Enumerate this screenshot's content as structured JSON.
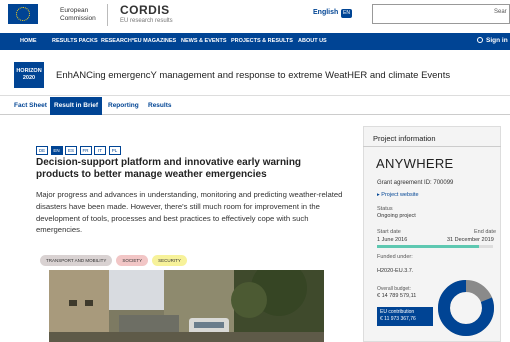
{
  "header": {
    "ec_line1": "European",
    "ec_line2": "Commission",
    "site_name": "CORDIS",
    "site_tagline": "EU research results",
    "language": "English",
    "language_code": "EN",
    "search_button": "Sear"
  },
  "nav": {
    "items": [
      "HOME",
      "RESULTS PACKS",
      "RESEARCH*EU MAGAZINES",
      "NEWS & EVENTS",
      "PROJECTS & RESULTS",
      "ABOUT US"
    ],
    "signin": "Sign in"
  },
  "project": {
    "programme_badge_line1": "HORIZON",
    "programme_badge_line2": "2020",
    "title": "EnhANCing emergencY management and response to extreme WeatHER and climate Events"
  },
  "tabs": [
    "Fact Sheet",
    "Result in Brief",
    "Reporting",
    "Results"
  ],
  "active_tab": "Result in Brief",
  "languages": [
    "DE",
    "EN",
    "ES",
    "FR",
    "IT",
    "PL"
  ],
  "active_language": "EN",
  "brief": {
    "title": "Decision-support platform and innovative early warning products to better manage weather emergencies",
    "body": "Major progress and advances in understanding, monitoring and predicting weather-related disasters have been made. However, there's still much room for improvement in the development of tools, processes and best practices to effectively cope with such emergencies.",
    "tags": [
      "TRANSPORT AND MOBILITY",
      "SOCIETY",
      "SECURITY"
    ]
  },
  "sidebar": {
    "heading": "Project information",
    "acronym": "ANYWHERE",
    "grant": "Grant agreement ID: 700099",
    "website": "Project website",
    "status_label": "Status",
    "status_value": "Ongoing project",
    "start_label": "Start date",
    "start_value": "1 June 2016",
    "end_label": "End date",
    "end_value": "31 December 2019",
    "timeline_progress": 0.88,
    "funded_label": "Funded under:",
    "funded_value": "H2020-EU.3.7.",
    "budget_label": "Overall budget:",
    "budget_value": "€ 14 789 579,11",
    "contrib_label": "EU contribution",
    "contrib_value": "€ 11 973 367,76",
    "eu_share": 0.81
  },
  "colors": {
    "primary": "#004494",
    "teal": "#5ec8b1",
    "donut_rest": "#8a8a8a"
  }
}
